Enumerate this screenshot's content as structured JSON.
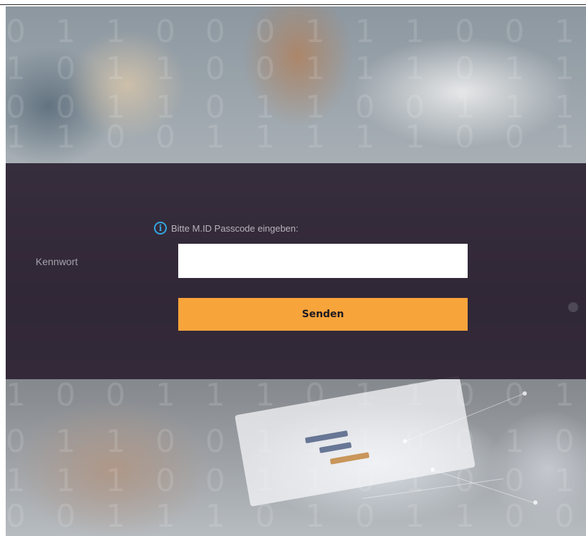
{
  "login": {
    "notice_icon": "info-icon",
    "notice_text": "Bitte M.ID Passcode eingeben:",
    "password_label": "Kennwort",
    "password_value": "",
    "submit_label": "Senden"
  },
  "colors": {
    "overlay": "#2a1f30",
    "accent_button": "#f7a43b",
    "info_icon": "#35a6e0",
    "input_background": "#ffffff"
  }
}
